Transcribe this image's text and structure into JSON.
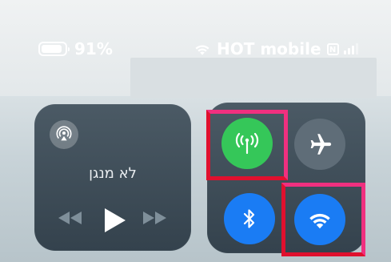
{
  "status_bar": {
    "battery_percent": "91%",
    "battery_level": 0.91,
    "carrier": "HOT mobile",
    "carrier_badge": "N"
  },
  "media": {
    "now_playing": "לא מנגן"
  },
  "highlight_color": "#e0102e",
  "accent_colors": {
    "cellular_on": "#35c759",
    "wifi_on": "#1a7cf4",
    "bluetooth_on": "#1a7cf4"
  }
}
